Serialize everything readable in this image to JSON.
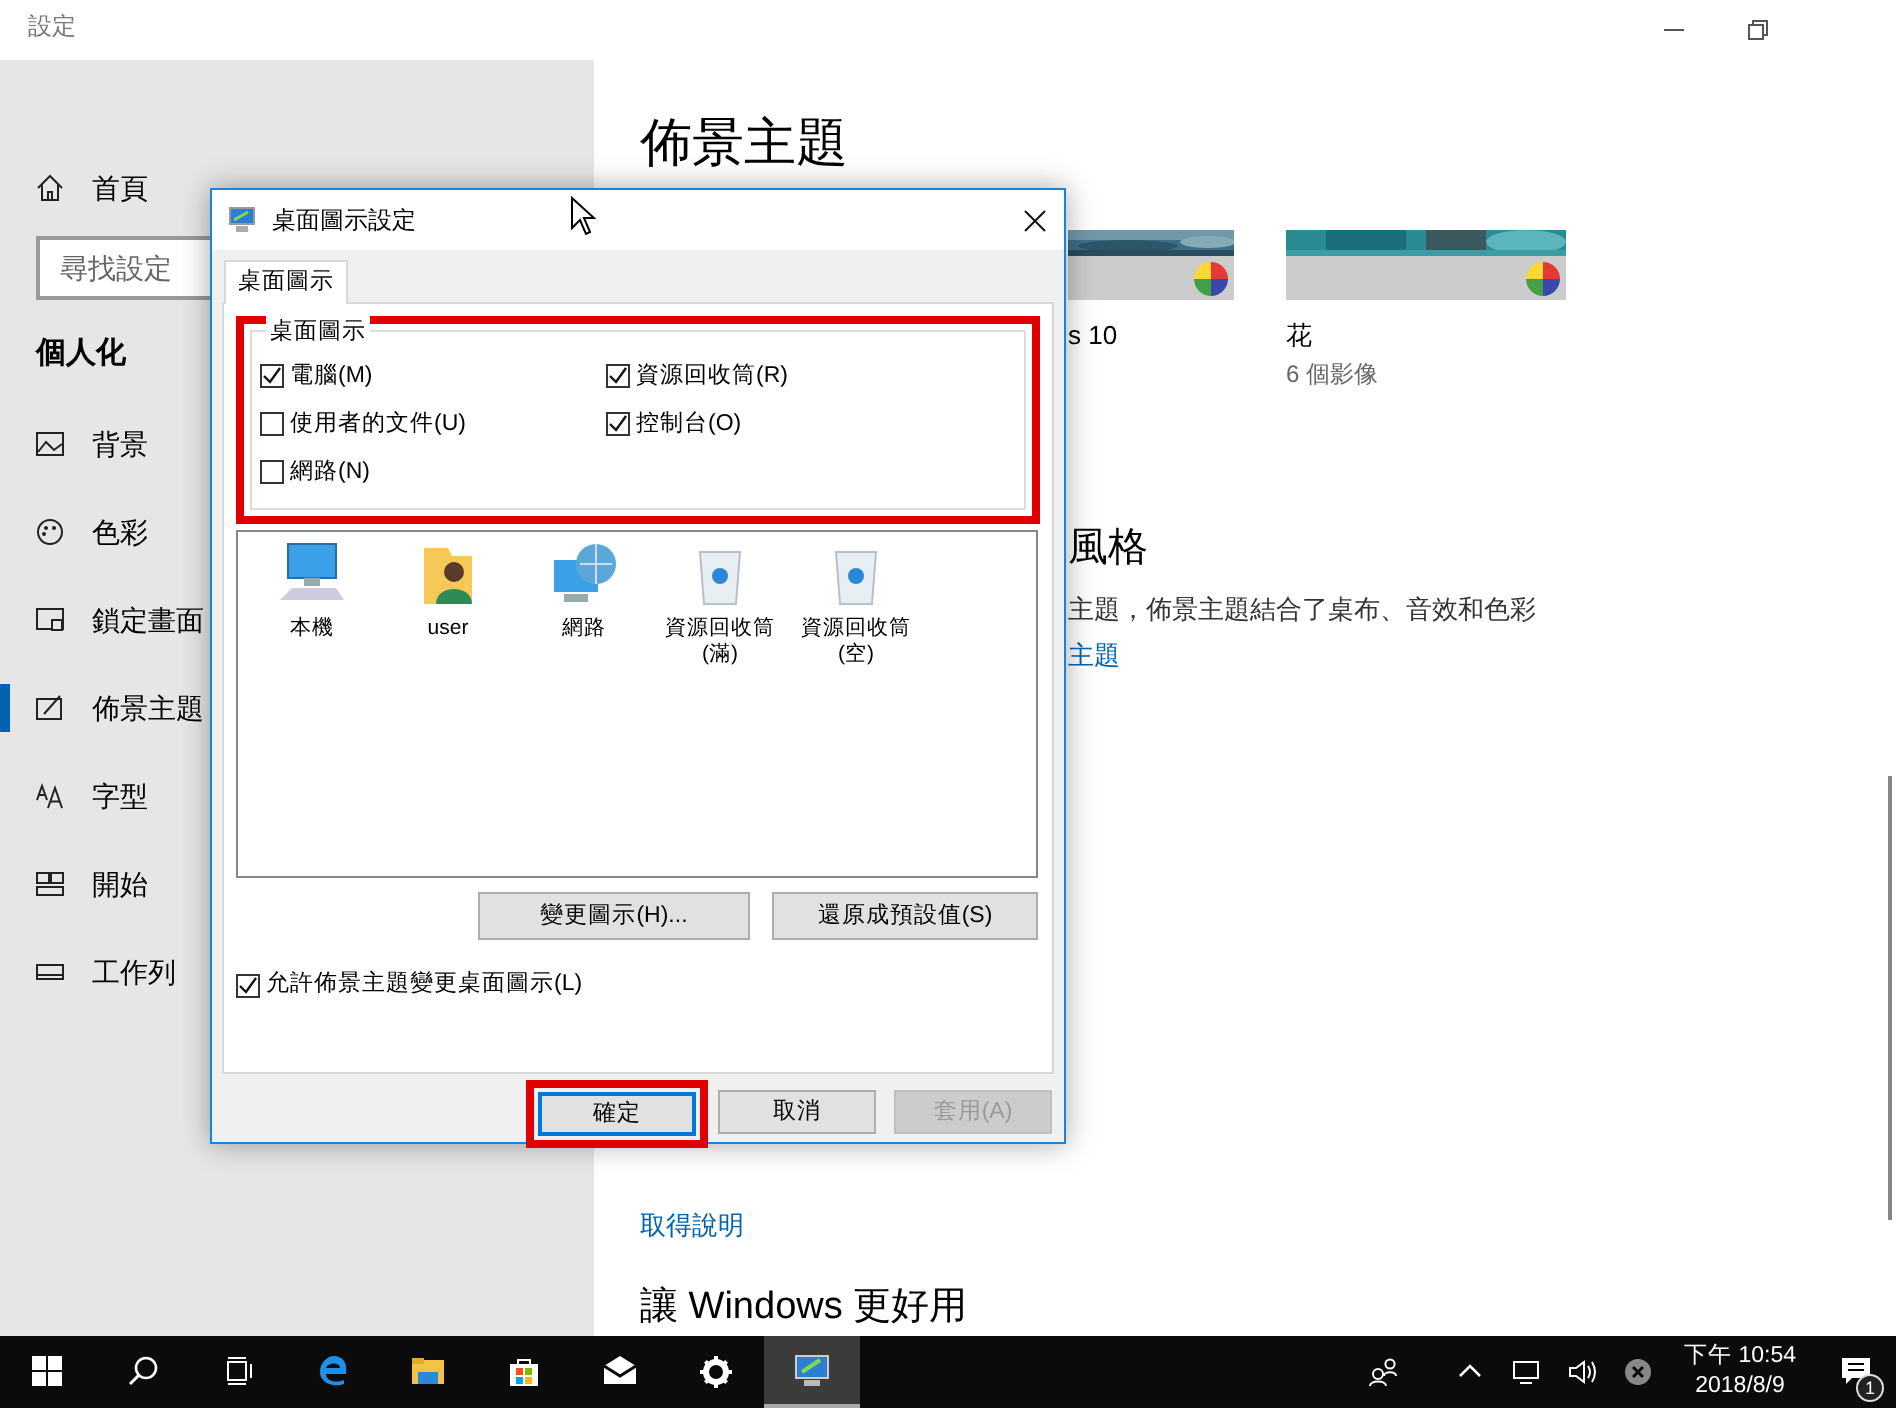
{
  "window": {
    "title": "設定"
  },
  "sidebar": {
    "home": "首頁",
    "search_placeholder": "尋找設定",
    "section": "個人化",
    "items": [
      {
        "label": "背景",
        "selected": false
      },
      {
        "label": "色彩",
        "selected": false
      },
      {
        "label": "鎖定畫面",
        "selected": false
      },
      {
        "label": "佈景主題",
        "selected": true
      },
      {
        "label": "字型",
        "selected": false
      },
      {
        "label": "開始",
        "selected": false
      },
      {
        "label": "工作列",
        "selected": false
      }
    ]
  },
  "main": {
    "heading": "佈景主題",
    "themes": [
      {
        "name": "s 10"
      },
      {
        "name": "花",
        "count": "6 個影像"
      }
    ],
    "style_heading": "風格",
    "description": "主題，佈景主題結合了桌布、音效和色彩",
    "link": "主題",
    "help_link": "取得說明",
    "bottom_heading": "讓 Windows 更好用"
  },
  "dialog": {
    "title": "桌面圖示設定",
    "tabs": [
      {
        "label": "桌面圖示",
        "selected": true
      }
    ],
    "group": {
      "legend": "桌面圖示",
      "highlighted": true,
      "options": [
        {
          "label": "電腦(M)",
          "checked": true
        },
        {
          "label": "使用者的文件(U)",
          "checked": false
        },
        {
          "label": "網路(N)",
          "checked": false
        },
        {
          "label": "資源回收筒(R)",
          "checked": true
        },
        {
          "label": "控制台(O)",
          "checked": true
        }
      ]
    },
    "icons": [
      {
        "label": "本機",
        "kind": "computer"
      },
      {
        "label": "user",
        "kind": "user"
      },
      {
        "label": "網路",
        "kind": "network"
      },
      {
        "label": "資源回收筒 (滿)",
        "kind": "bin"
      },
      {
        "label": "資源回收筒 (空)",
        "kind": "bin"
      }
    ],
    "icon_buttons": [
      "變更圖示(H)...",
      "還原成預設值(S)"
    ],
    "allow_themes": {
      "label": "允許佈景主題變更桌面圖示(L)",
      "checked": true
    },
    "buttons": [
      {
        "label": "確定",
        "default": true,
        "highlighted": true,
        "disabled": false
      },
      {
        "label": "取消",
        "default": false,
        "highlighted": false,
        "disabled": false
      },
      {
        "label": "套用(A)",
        "default": false,
        "highlighted": false,
        "disabled": true
      }
    ]
  },
  "taskbar": {
    "time": "下午 10:54",
    "date": "2018/8/9",
    "notifications": "1"
  }
}
